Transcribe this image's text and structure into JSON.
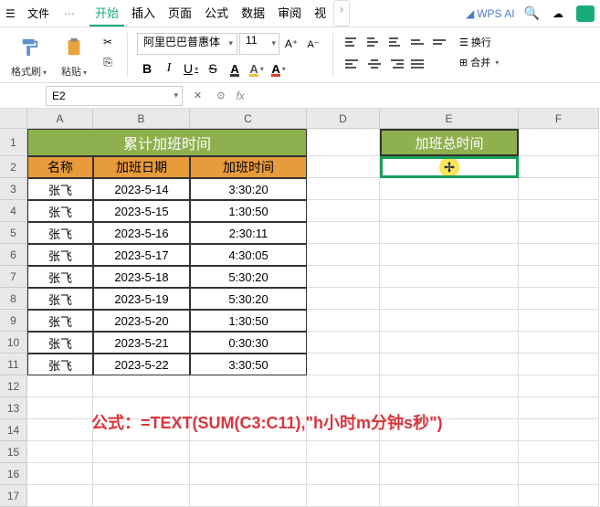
{
  "titlebar": {
    "file_label": "文件",
    "tabs": [
      "开始",
      "插入",
      "页面",
      "公式",
      "数据",
      "审阅",
      "视"
    ],
    "active_tab_index": 0,
    "wps_ai": "WPS AI"
  },
  "ribbon": {
    "format_painter": "格式刷",
    "paste": "粘贴",
    "font_name": "阿里巴巴普惠体",
    "font_size": "11",
    "wrap_text": "换行",
    "merge": "合并"
  },
  "namebox": {
    "cell_ref": "E2",
    "fx": "fx"
  },
  "columns": [
    "A",
    "B",
    "C",
    "D",
    "E",
    "F"
  ],
  "rows": [
    "1",
    "2",
    "3",
    "4",
    "5",
    "6",
    "7",
    "8",
    "9",
    "10",
    "11",
    "12",
    "13",
    "14",
    "15",
    "16",
    "17"
  ],
  "table": {
    "title": "累计加班时间",
    "headers": [
      "名称",
      "加班日期",
      "加班时间"
    ],
    "data": [
      [
        "张飞",
        "2023-5-14",
        "3:30:20"
      ],
      [
        "张飞",
        "2023-5-15",
        "1:30:50"
      ],
      [
        "张飞",
        "2023-5-16",
        "2:30:11"
      ],
      [
        "张飞",
        "2023-5-17",
        "4:30:05"
      ],
      [
        "张飞",
        "2023-5-18",
        "5:30:20"
      ],
      [
        "张飞",
        "2023-5-19",
        "5:30:20"
      ],
      [
        "张飞",
        "2023-5-20",
        "1:30:50"
      ],
      [
        "张飞",
        "2023-5-21",
        "0:30:30"
      ],
      [
        "张飞",
        "2023-5-22",
        "3:30:50"
      ]
    ]
  },
  "e_column": {
    "title": "加班总时间"
  },
  "formula_text": "公式：=TEXT(SUM(C3:C11),\"h小时m分钟s秒\")"
}
